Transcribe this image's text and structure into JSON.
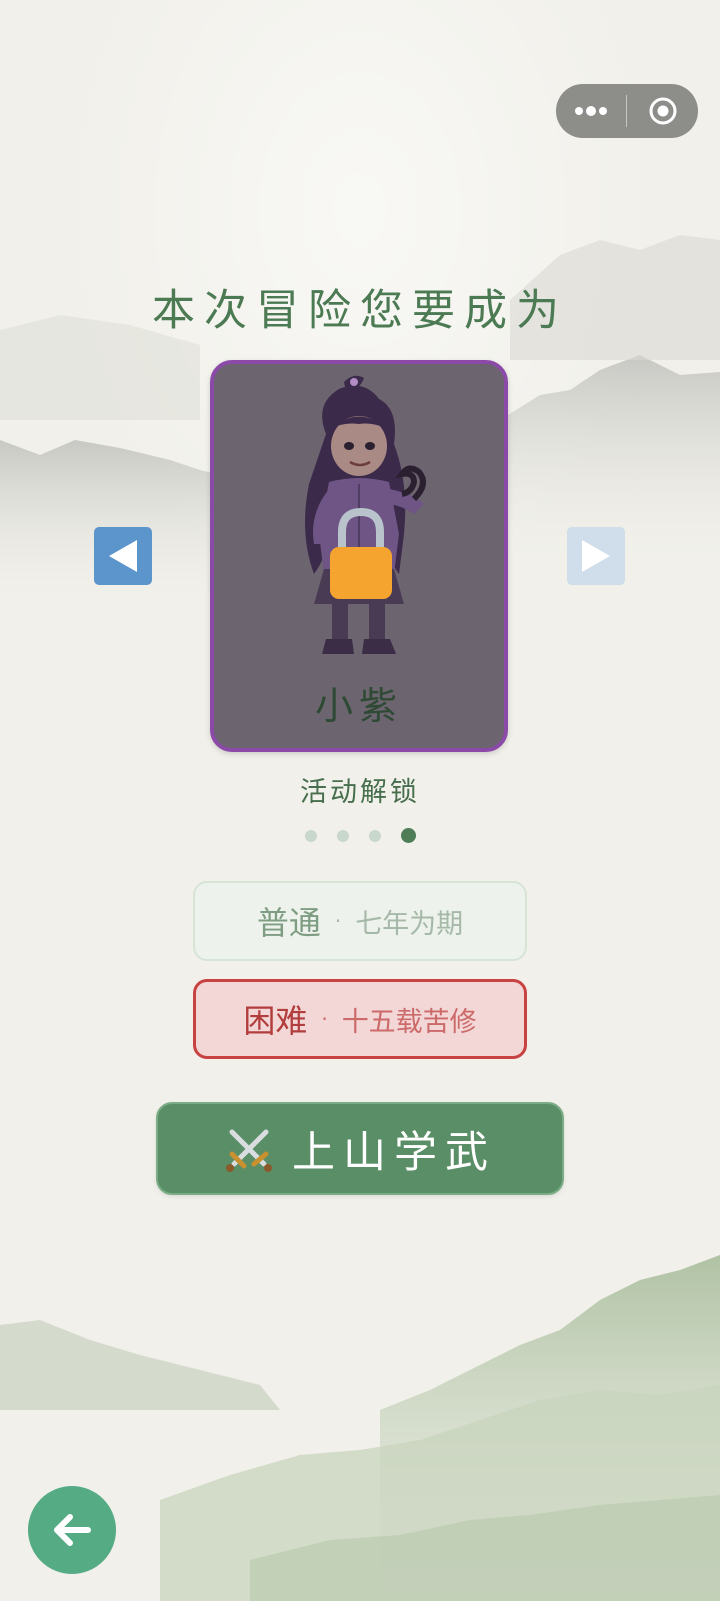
{
  "capsule": {
    "more_icon": "more-dots-icon",
    "close_icon": "target-circle-icon"
  },
  "title": "本次冒险您要成为",
  "carousel": {
    "character_name": "小紫",
    "locked": true,
    "lock_icon": "padlock-icon",
    "left_arrow_icon": "triangle-left-icon",
    "right_arrow_icon": "triangle-right-icon",
    "unlock_text": "活动解锁",
    "page_count": 4,
    "active_page": 4
  },
  "difficulty": {
    "normal": {
      "label": "普通",
      "separator": "·",
      "desc": "七年为期"
    },
    "hard": {
      "label": "困难",
      "separator": "·",
      "desc": "十五载苦修",
      "selected": true
    }
  },
  "start_button": {
    "icon": "crossed-swords-icon",
    "label": "上山学武"
  },
  "back_button": {
    "icon": "arrow-left-icon"
  },
  "colors": {
    "accent": "#5a8e67",
    "hard": "#c94242",
    "card_border": "#8b4aa8",
    "lock": "#f5a52f"
  }
}
